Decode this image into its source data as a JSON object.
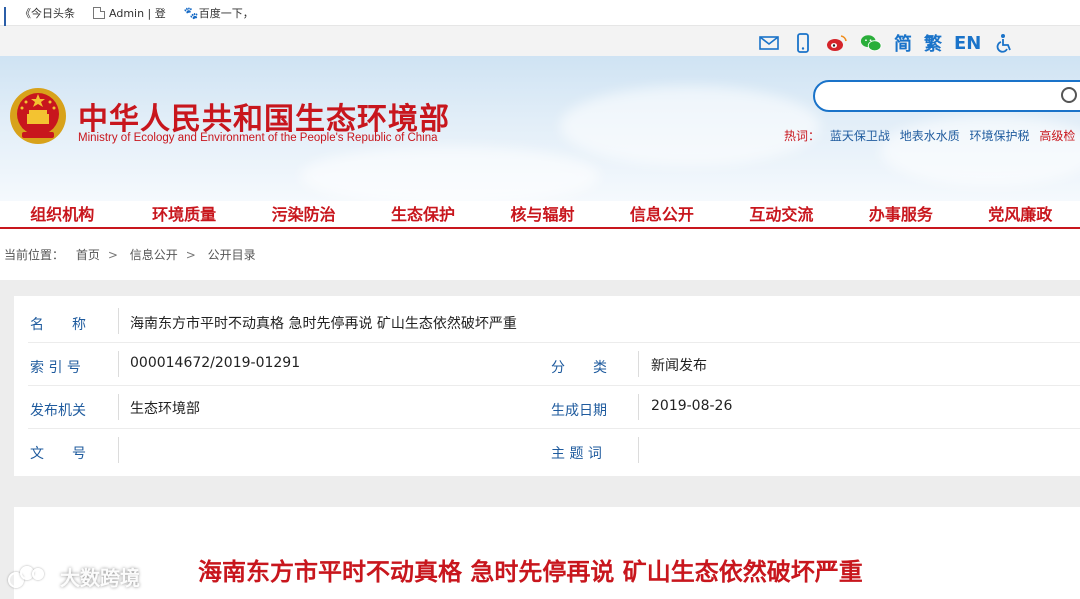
{
  "bookmarks": [
    {
      "label": "《今日头条",
      "icon": "bar-chart-icon"
    },
    {
      "label": "Admin | 登",
      "icon": "page-icon"
    },
    {
      "label": "百度一下，",
      "icon": "baidu-paw-icon"
    }
  ],
  "utility": {
    "icons": [
      "mail-icon",
      "mobile-icon",
      "weibo-icon",
      "wechat-icon"
    ],
    "simplified": "简",
    "traditional": "繁",
    "english": "EN",
    "accessibility_icon": "wheelchair-icon"
  },
  "header": {
    "title": "中华人民共和国生态环境部",
    "subtitle": "Ministry of Ecology and Environment of the People's Republic of China",
    "search_placeholder": "",
    "hot_label": "热词：",
    "hot_words": [
      "蓝天保卫战",
      "地表水水质",
      "环境保护税",
      "高级检"
    ]
  },
  "nav": [
    "组织机构",
    "环境质量",
    "污染防治",
    "生态保护",
    "核与辐射",
    "信息公开",
    "互动交流",
    "办事服务",
    "党风廉政"
  ],
  "breadcrumb": {
    "label": "当前位置：",
    "items": [
      "首页",
      "信息公开",
      "公开目录"
    ],
    "sep": ">"
  },
  "info": {
    "name_label": "名　　称",
    "name_value": "海南东方市平时不动真格 急时先停再说 矿山生态依然破坏严重",
    "index_label": "索 引 号",
    "index_value": "000014672/2019-01291",
    "category_label": "分　　类",
    "category_value": "新闻发布",
    "issuer_label": "发布机关",
    "issuer_value": "生态环境部",
    "date_label": "生成日期",
    "date_value": "2019-08-26",
    "doc_label": "文　　号",
    "doc_value": "",
    "subject_label": "主 题 词",
    "subject_value": ""
  },
  "article": {
    "title": "海南东方市平时不动真格 急时先停再说 矿山生态依然破坏严重"
  },
  "watermark": {
    "text": "大数跨境"
  },
  "colors": {
    "brand_red": "#c8161d",
    "link_blue": "#1f5b9e",
    "icon_blue": "#1a73c9"
  }
}
